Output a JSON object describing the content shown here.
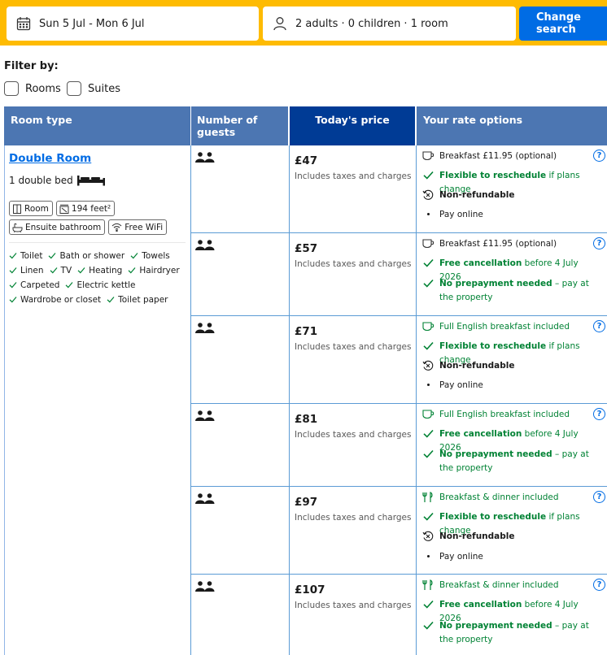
{
  "search": {
    "dates": "Sun 5 Jul - Mon 6 Jul",
    "guests": "2 adults · 0 children · 1 room",
    "button": "Change search"
  },
  "filter": {
    "title": "Filter by:",
    "options": [
      "Rooms",
      "Suites"
    ]
  },
  "table": {
    "headers": [
      "Room type",
      "Number of guests",
      "Today's price",
      "Your rate options"
    ],
    "room": {
      "name": "Double Room",
      "bed": "1 double bed",
      "chips": [
        "Room",
        "194 feet²",
        "Ensuite bathroom",
        "Free WiFi"
      ],
      "amenities": [
        "Toilet",
        "Bath or shower",
        "Towels",
        "Linen",
        "TV",
        "Heating",
        "Hairdryer",
        "Carpeted",
        "Electric kettle",
        "Wardrobe or closet",
        "Toilet paper"
      ]
    },
    "price_note": "Includes taxes and charges",
    "rows": [
      {
        "price": "£47",
        "meal": "Breakfast £11.95 (optional)",
        "policy_bold": "Flexible to reschedule",
        "policy_rest": " if plans change",
        "third_bold": "Non-refundable",
        "fourth": "Pay online"
      },
      {
        "price": "£57",
        "meal": "Breakfast £11.95 (optional)",
        "policy_bold": "Free cancellation",
        "policy_rest": " before 4 July 2026",
        "third_bold": "No prepayment needed",
        "third_rest": " – pay at the property"
      },
      {
        "price": "£71",
        "meal": "Full English breakfast included",
        "policy_bold": "Flexible to reschedule",
        "policy_rest": " if plans change",
        "third_bold": "Non-refundable",
        "fourth": "Pay online"
      },
      {
        "price": "£81",
        "meal": "Full English breakfast included",
        "policy_bold": "Free cancellation",
        "policy_rest": " before 4 July 2026",
        "third_bold": "No prepayment needed",
        "third_rest": " – pay at the property"
      },
      {
        "price": "£97",
        "meal": "Breakfast & dinner included",
        "policy_bold": "Flexible to reschedule",
        "policy_rest": " if plans change",
        "third_bold": "Non-refundable",
        "fourth": "Pay online"
      },
      {
        "price": "£107",
        "meal": "Breakfast & dinner included",
        "policy_bold": "Free cancellation",
        "policy_rest": " before 4 July 2026",
        "third_bold": "No prepayment needed",
        "third_rest": " – pay at the property"
      }
    ],
    "help_glyph": "?"
  },
  "colors": {
    "search_bar": "#febb02",
    "primary_blue": "#006ce4",
    "header_blue": "#4c76b2",
    "price_header": "#003b95",
    "green": "#008234"
  }
}
